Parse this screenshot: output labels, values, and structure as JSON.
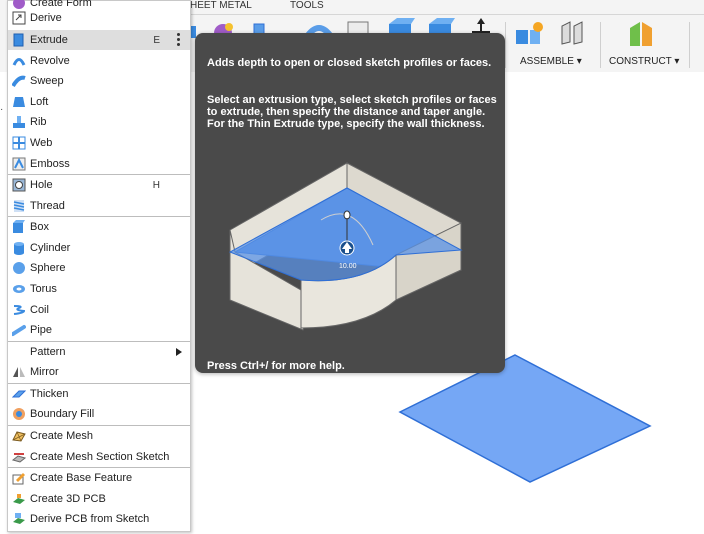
{
  "toolbar": {
    "tabs": [
      "HEET METAL",
      "TOOLS"
    ],
    "groups": [
      {
        "label": "ASSEMBLE",
        "icon": "assemble-icon"
      },
      {
        "label": "CONSTRUCT",
        "icon": "construct-icon"
      }
    ]
  },
  "menu": {
    "items": [
      {
        "label": "Create Form",
        "icon": "create-form-icon",
        "shortcut": ""
      },
      {
        "label": "Derive",
        "icon": "derive-icon",
        "shortcut": ""
      },
      {
        "label": "Extrude",
        "icon": "extrude-icon",
        "shortcut": "E",
        "selected": true
      },
      {
        "label": "Revolve",
        "icon": "revolve-icon",
        "shortcut": ""
      },
      {
        "label": "Sweep",
        "icon": "sweep-icon",
        "shortcut": ""
      },
      {
        "label": "Loft",
        "icon": "loft-icon",
        "shortcut": ""
      },
      {
        "label": "Rib",
        "icon": "rib-icon",
        "shortcut": ""
      },
      {
        "label": "Web",
        "icon": "web-icon",
        "shortcut": ""
      },
      {
        "label": "Emboss",
        "icon": "emboss-icon",
        "shortcut": ""
      },
      {
        "label": "Hole",
        "icon": "hole-icon",
        "shortcut": "H"
      },
      {
        "label": "Thread",
        "icon": "thread-icon",
        "shortcut": ""
      },
      {
        "label": "Box",
        "icon": "box-icon",
        "shortcut": ""
      },
      {
        "label": "Cylinder",
        "icon": "cylinder-icon",
        "shortcut": ""
      },
      {
        "label": "Sphere",
        "icon": "sphere-icon",
        "shortcut": ""
      },
      {
        "label": "Torus",
        "icon": "torus-icon",
        "shortcut": ""
      },
      {
        "label": "Coil",
        "icon": "coil-icon",
        "shortcut": ""
      },
      {
        "label": "Pipe",
        "icon": "pipe-icon",
        "shortcut": ""
      },
      {
        "label": "Pattern",
        "icon": "",
        "shortcut": "",
        "submenu": true
      },
      {
        "label": "Mirror",
        "icon": "mirror-icon",
        "shortcut": ""
      },
      {
        "label": "Thicken",
        "icon": "thicken-icon",
        "shortcut": ""
      },
      {
        "label": "Boundary Fill",
        "icon": "boundary-fill-icon",
        "shortcut": ""
      },
      {
        "label": "Create Mesh",
        "icon": "create-mesh-icon",
        "shortcut": ""
      },
      {
        "label": "Create Mesh Section Sketch",
        "icon": "mesh-section-sketch-icon",
        "shortcut": ""
      },
      {
        "label": "Create Base Feature",
        "icon": "base-feature-icon",
        "shortcut": ""
      },
      {
        "label": "Create 3D PCB",
        "icon": "pcb-3d-icon",
        "shortcut": ""
      },
      {
        "label": "Derive PCB from Sketch",
        "icon": "derive-pcb-icon",
        "shortcut": ""
      }
    ]
  },
  "tooltip": {
    "summary": "Adds depth to open or closed sketch profiles or faces.",
    "description": "Select an extrusion type, select sketch profiles or faces to extrude, then specify the distance and taper angle. For the Thin Extrude type, specify the wall thickness.",
    "dimension": "10.00",
    "help": "Press Ctrl+/ for more help."
  },
  "colors": {
    "tooltip_bg": "#4a4a4a",
    "selection": "#dedede",
    "plane_fill": "#75a7f5",
    "plane_stroke": "#2f6fd6"
  }
}
